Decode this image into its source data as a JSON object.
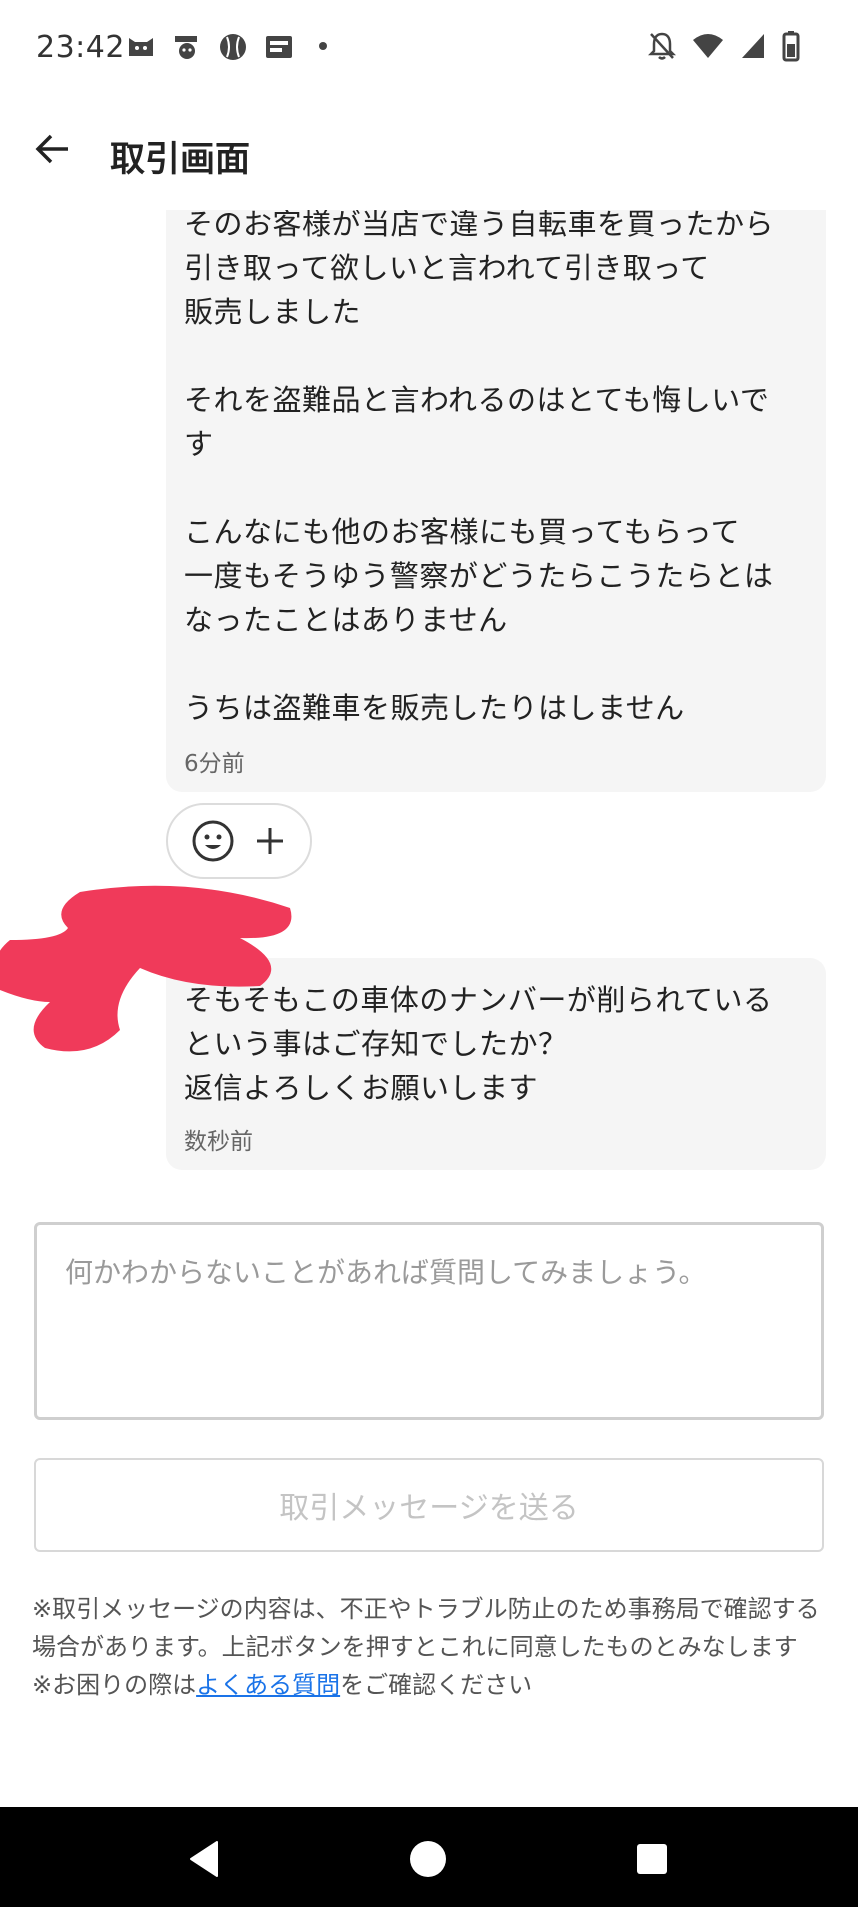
{
  "status_bar": {
    "time": "23:42",
    "notification_icons": [
      "cat-icon",
      "mascot-icon",
      "baseball-icon",
      "app-icon",
      "dot-icon"
    ],
    "system_icons": [
      "bell-off-icon",
      "wifi-icon",
      "signal-icon",
      "battery-icon"
    ]
  },
  "header": {
    "back_icon": "arrow-left-icon",
    "title": "取引画面"
  },
  "messages": [
    {
      "text": "そのお客様が当店で違う自転車を買ったから\n引き取って欲しいと言われて引き取って\n販売しました\n\nそれを盗難品と言われるのはとても悔しいで\nす\n\nこんなにも他のお客様にも買ってもらって\n一度もそうゆう警察がどうたらこうたらとは\nなったことはありません\n\nうちは盗難車を販売したりはしません",
      "time": "6分前"
    },
    {
      "text": "そもそもこの車体のナンバーが削られている\nという事はご存知でしたか？\n返信よろしくお願いします",
      "time": "数秒前"
    }
  ],
  "reaction": {
    "emoji_icon": "smiley-icon",
    "add_icon": "plus-icon",
    "add_label": "+"
  },
  "composer": {
    "placeholder": "何かわからないことがあれば質問してみましょう。",
    "value": "",
    "send_label": "取引メッセージを送る"
  },
  "notes": {
    "line1": "※取引メッセージの内容は、不正やトラブル防止のため事務局で確認する場合があります。上記ボタンを押すとこれに同意したものとみなします",
    "line2_prefix": "※お困りの際は",
    "line2_link": "よくある質問",
    "line2_suffix": "をご確認ください"
  },
  "nav_bar": {
    "icons": [
      "back-triangle-icon",
      "home-circle-icon",
      "recents-square-icon"
    ]
  },
  "colors": {
    "bubble": "#f5f5f5",
    "link": "#1a73e8",
    "redaction": "#f03a5a"
  }
}
